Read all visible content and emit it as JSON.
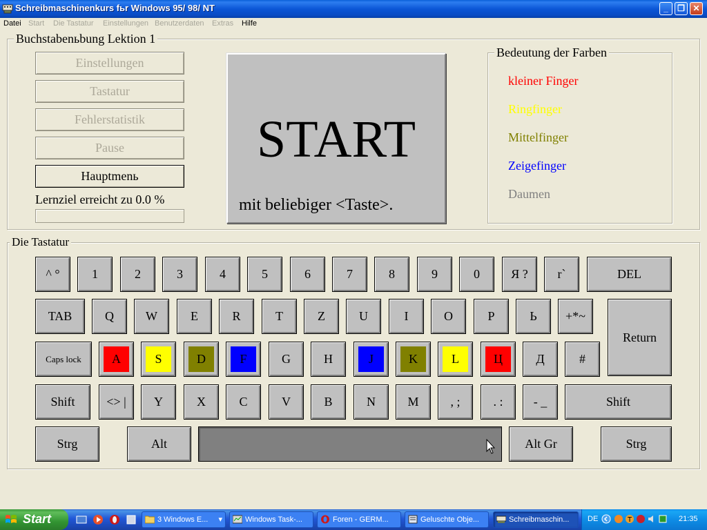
{
  "window": {
    "title": "Schreibmaschinenkurs fьr Windows 95/ 98/ NT"
  },
  "menu": [
    "Datei",
    "Start",
    "Die Tastatur",
    "Einstellungen",
    "Benutzerdaten",
    "Extras",
    "Hilfe"
  ],
  "lesson": {
    "group_title": "Buchstabenьbung Lektion 1",
    "buttons": [
      "Einstellungen",
      "Tastatur",
      "Fehlerstatistik",
      "Pause",
      "Hauptmenь"
    ],
    "goal_text": "Lernziel erreicht zu 0.0 %",
    "goal_progress": 0.0
  },
  "start_panel": {
    "word": "START",
    "hint": "mit beliebiger <Taste>."
  },
  "legend": {
    "title": "Bedeutung der Farben",
    "items": [
      {
        "label": "kleiner Finger",
        "color": "#ff0000"
      },
      {
        "label": "Ringfinger",
        "color": "#ffff00"
      },
      {
        "label": "Mittelfinger",
        "color": "#808000"
      },
      {
        "label": "Zeigefinger",
        "color": "#0000ff"
      },
      {
        "label": "Daumen",
        "color": "#808080"
      }
    ]
  },
  "keyboard": {
    "title": "Die Tastatur",
    "row1": [
      "^ °",
      "1",
      "2",
      "3",
      "4",
      "5",
      "6",
      "7",
      "8",
      "9",
      "0",
      "Я ?",
      "r`",
      "DEL"
    ],
    "row2": [
      "TAB",
      "Q",
      "W",
      "E",
      "R",
      "T",
      "Z",
      "U",
      "I",
      "O",
      "P",
      "Ь",
      "+*~",
      "Return"
    ],
    "row3": [
      "Caps lock",
      "A",
      "S",
      "D",
      "F",
      "G",
      "H",
      "J",
      "K",
      "L",
      "Ц",
      "Д",
      "#"
    ],
    "row4": [
      "Shift",
      "<> |",
      "Y",
      "X",
      "C",
      "V",
      "B",
      "N",
      "M",
      ", ;",
      ". :",
      "- _",
      "Shift"
    ],
    "row5": [
      "Strg",
      "Alt",
      "",
      "Alt Gr",
      "Strg"
    ],
    "colors": {
      "A": "#ff0000",
      "S": "#ffff00",
      "D": "#808000",
      "F": "#0000ff",
      "J": "#0000ff",
      "K": "#808000",
      "L": "#ffff00",
      "Ц": "#ff0000"
    }
  },
  "taskbar": {
    "start": "Start",
    "items": [
      {
        "label": "3 Windows E...",
        "icon": "folder-icon"
      },
      {
        "label": "Windows Task-...",
        "icon": "task-manager-icon"
      },
      {
        "label": "Foren - GERM...",
        "icon": "opera-icon"
      },
      {
        "label": "Geluschte Obje...",
        "icon": "recycle-icon"
      },
      {
        "label": "Schreibmaschin...",
        "icon": "keyboard-app-icon",
        "active": true
      }
    ],
    "language": "DE",
    "clock": "21:35"
  }
}
